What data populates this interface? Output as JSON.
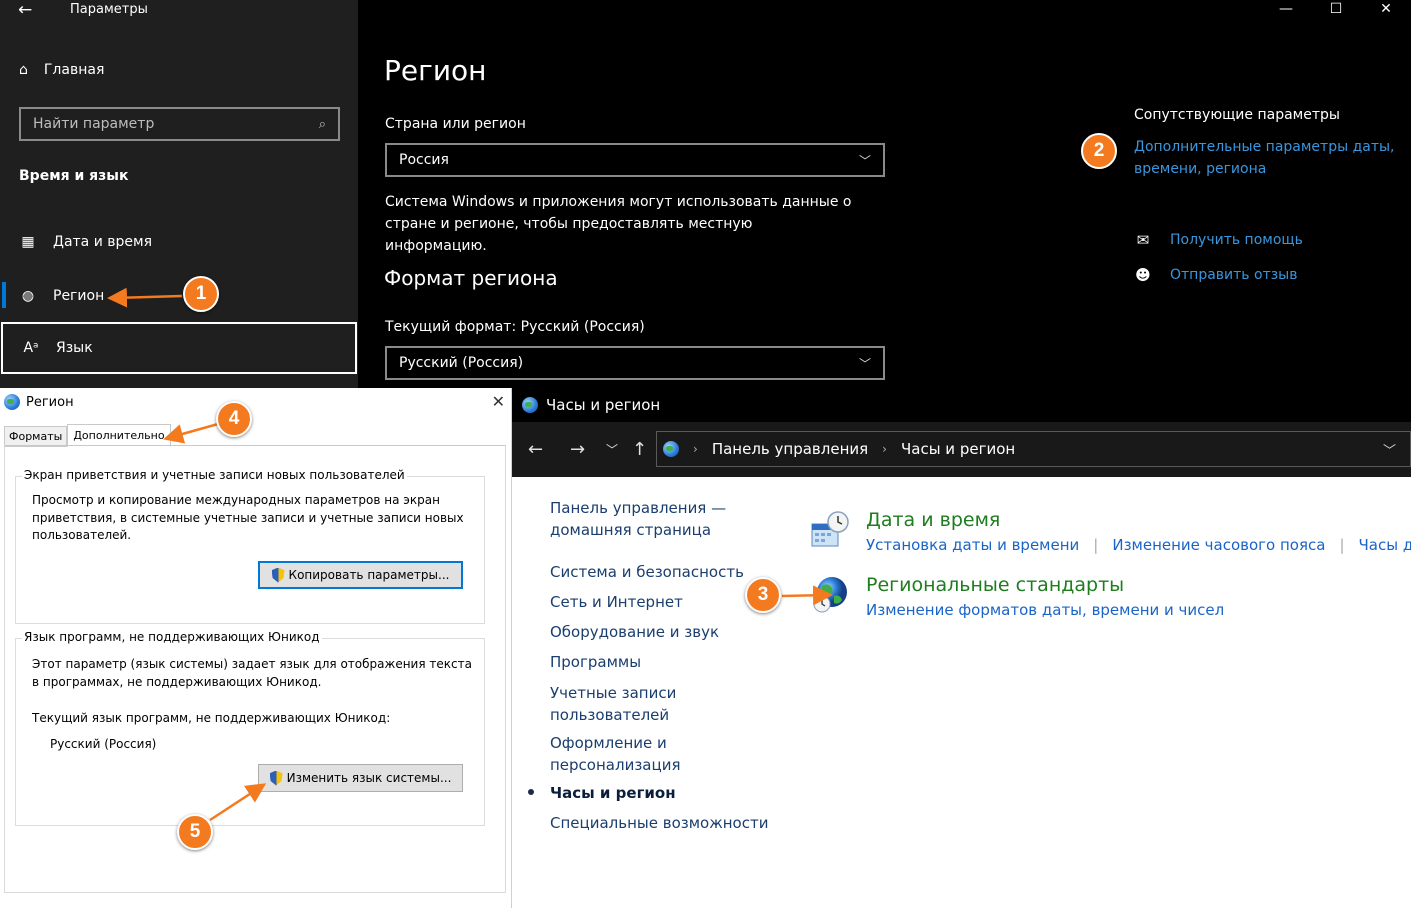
{
  "settings": {
    "window_title": "Параметры",
    "window_controls": [
      "—",
      "☐",
      "✕"
    ],
    "home_label": "Главная",
    "search_placeholder": "Найти параметр",
    "section_label": "Время и язык",
    "nav": [
      {
        "label": "Дата и время",
        "icon": "calendar-clock-icon"
      },
      {
        "label": "Регион",
        "icon": "globe-icon"
      },
      {
        "label": "Язык",
        "icon": "language-icon"
      }
    ],
    "page_title": "Регион",
    "country_label": "Страна или регион",
    "country_value": "Россия",
    "country_desc": "Система Windows и приложения могут использовать данные о стране и регионе, чтобы предоставлять местную информацию.",
    "format_heading": "Формат региона",
    "current_format_label": "Текущий формат: Русский (Россия)",
    "format_value": "Русский (Россия)",
    "related_title": "Сопутствующие параметры",
    "related_link": "Дополнительные параметры даты, времени, региона",
    "help_link": "Получить помощь",
    "feedback_link": "Отправить отзыв"
  },
  "region_dialog": {
    "title": "Регион",
    "tabs": [
      "Форматы",
      "Дополнительно"
    ],
    "group1_title": "Экран приветствия и учетные записи новых пользователей",
    "group1_text": "Просмотр и копирование международных параметров на экран приветствия, в системные учетные записи и учетные записи новых пользователей.",
    "copy_button": "Копировать параметры...",
    "group2_title": "Язык программ, не поддерживающих Юникод",
    "group2_text": "Этот параметр (язык системы) задает язык для отображения текста в программах, не поддерживающих Юникод.",
    "current_lang_label": "Текущий язык программ, не поддерживающих Юникод:",
    "current_lang_value": "Русский (Россия)",
    "change_button": "Изменить язык системы..."
  },
  "control_panel": {
    "title": "Часы и регион",
    "breadcrumb": [
      "Панель управления",
      "Часы и регион"
    ],
    "sidebar": [
      "Панель управления — домашняя страница",
      "Система и безопасность",
      "Сеть и Интернет",
      "Оборудование и звук",
      "Программы",
      "Учетные записи пользователей",
      "Оформление и персонализация",
      "Часы и регион",
      "Специальные возможности"
    ],
    "categories": [
      {
        "title": "Дата и время",
        "links": [
          "Установка даты и времени",
          "Изменение часового пояса",
          "Часы для р"
        ]
      },
      {
        "title": "Региональные стандарты",
        "links": [
          "Изменение форматов даты, времени и чисел"
        ]
      }
    ]
  },
  "annotations": {
    "badges": [
      "1",
      "2",
      "3",
      "4",
      "5"
    ],
    "color": "#f47a20"
  }
}
